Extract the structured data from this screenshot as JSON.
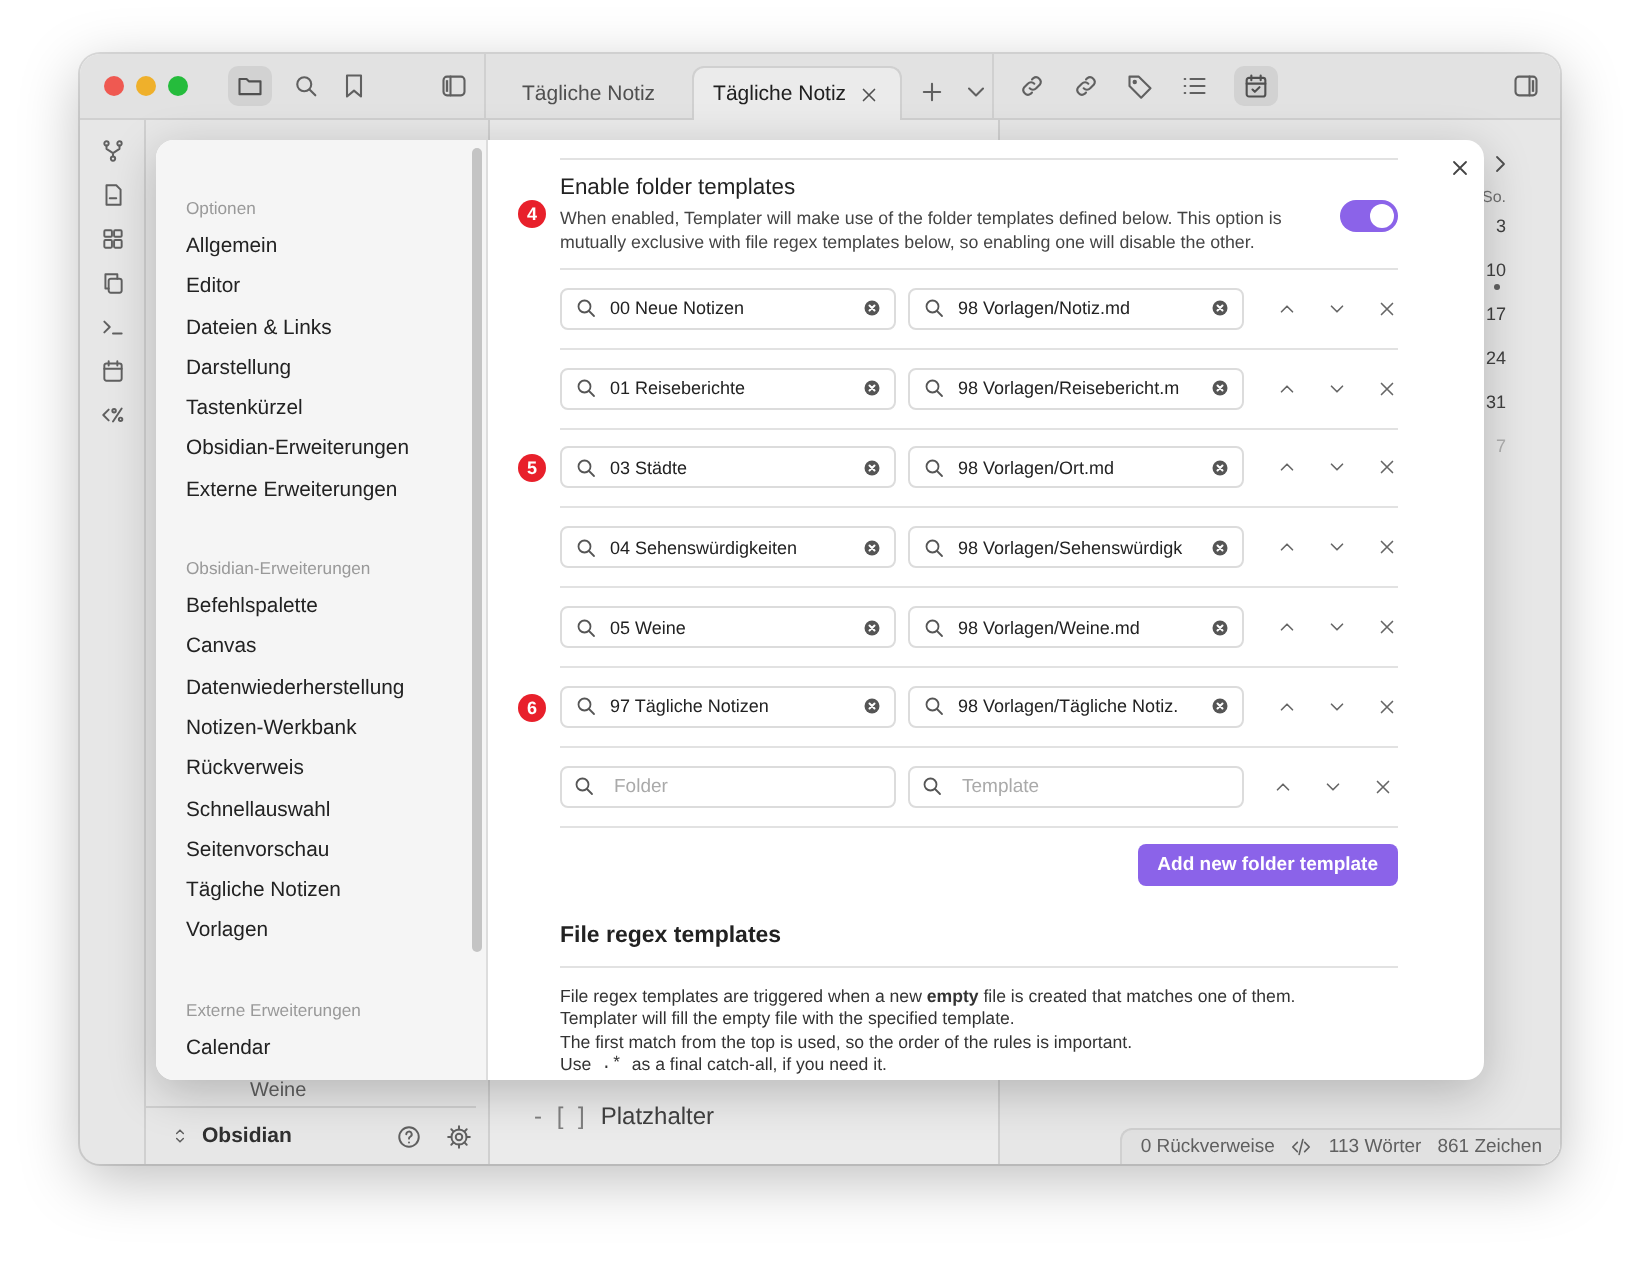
{
  "app": {
    "tabs": [
      {
        "label": "Tägliche Notiz",
        "selected": false
      },
      {
        "label": "Tägliche Notiz",
        "selected": true
      }
    ]
  },
  "file_explorer": {
    "item": "Weine",
    "vault": "Obsidian"
  },
  "editor": {
    "task_marker": "- [ ]",
    "task_text": "Platzhalter"
  },
  "calendar": {
    "weekday": "So.",
    "days": [
      {
        "label": "3",
        "outside_month": false,
        "has_note": false
      },
      {
        "label": "10",
        "outside_month": false,
        "has_note": true
      },
      {
        "label": "17",
        "outside_month": false,
        "has_note": false
      },
      {
        "label": "24",
        "outside_month": false,
        "has_note": false
      },
      {
        "label": "31",
        "outside_month": false,
        "has_note": false
      },
      {
        "label": "7",
        "outside_month": true,
        "has_note": false
      }
    ]
  },
  "status_bar": {
    "backlinks": "0 Rückverweise",
    "words": "113 Wörter",
    "characters": "861 Zeichen"
  },
  "settings_modal": {
    "sidebar": [
      {
        "heading": "Optionen",
        "items": [
          {
            "label": "Allgemein",
            "selected": false
          },
          {
            "label": "Editor",
            "selected": false
          },
          {
            "label": "Dateien & Links",
            "selected": false
          },
          {
            "label": "Darstellung",
            "selected": false
          },
          {
            "label": "Tastenkürzel",
            "selected": false
          },
          {
            "label": "Obsidian-Erweiterungen",
            "selected": false
          },
          {
            "label": "Externe Erweiterungen",
            "selected": false
          }
        ]
      },
      {
        "heading": "Obsidian-Erweiterungen",
        "items": [
          {
            "label": "Befehlspalette",
            "selected": false
          },
          {
            "label": "Canvas",
            "selected": false
          },
          {
            "label": "Datenwiederherstellung",
            "selected": false
          },
          {
            "label": "Notizen-Werkbank",
            "selected": false
          },
          {
            "label": "Rückverweis",
            "selected": false
          },
          {
            "label": "Schnellauswahl",
            "selected": false
          },
          {
            "label": "Seitenvorschau",
            "selected": false
          },
          {
            "label": "Tägliche Notizen",
            "selected": false
          },
          {
            "label": "Vorlagen",
            "selected": false
          }
        ]
      },
      {
        "heading": "Externe Erweiterungen",
        "items": [
          {
            "label": "Calendar",
            "selected": false
          }
        ]
      }
    ],
    "folder_templates": {
      "marker": "4",
      "title": "Enable folder templates",
      "description": "When enabled, Templater will make use of the folder templates defined below. This option is mutually exclusive with file regex templates below, so enabling one will disable the other.",
      "on": true,
      "rows": [
        {
          "marker": "",
          "folder": "00 Neue Notizen",
          "template": "98 Vorlagen/Notiz.md"
        },
        {
          "marker": "",
          "folder": "01 Reiseberichte",
          "template": "98 Vorlagen/Reisebericht.m"
        },
        {
          "marker": "5",
          "folder": "03 Städte",
          "template": "98 Vorlagen/Ort.md"
        },
        {
          "marker": "",
          "folder": "04 Sehenswürdigkeiten",
          "template": "98 Vorlagen/Sehenswürdigk"
        },
        {
          "marker": "",
          "folder": "05 Weine",
          "template": "98 Vorlagen/Weine.md"
        },
        {
          "marker": "6",
          "folder": "97 Tägliche Notizen",
          "template": "98 Vorlagen/Tägliche Notiz."
        }
      ],
      "new_row": {
        "folder_placeholder": "Folder",
        "template_placeholder": "Template"
      },
      "add_button": "Add new folder template"
    },
    "file_regex": {
      "title": "File regex templates",
      "lines": [
        {
          "kind": "text",
          "text": "File regex templates are triggered when a new **empty** file is created that matches one of them."
        },
        {
          "kind": "text",
          "text": "Templater will fill the empty file with the specified template."
        },
        {
          "kind": "text",
          "text": "The first match from the top is used, so the order of the rules is important."
        },
        {
          "kind": "code_hint",
          "before": "Use",
          "code": ".*",
          "after": "as a final catch-all, if you need it."
        }
      ]
    }
  }
}
